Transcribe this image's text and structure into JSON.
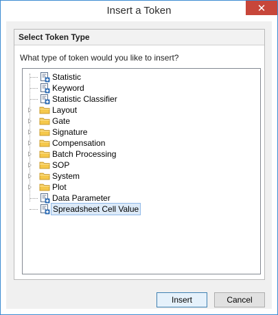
{
  "window": {
    "title": "Insert a Token",
    "close_glyph": "✕"
  },
  "panel": {
    "header": "Select Token Type",
    "question": "What type of token would you like to insert?"
  },
  "tree": {
    "items": [
      {
        "label": "Statistic",
        "kind": "token",
        "expandable": false
      },
      {
        "label": "Keyword",
        "kind": "token",
        "expandable": false
      },
      {
        "label": "Statistic Classifier",
        "kind": "token",
        "expandable": false
      },
      {
        "label": "Layout",
        "kind": "folder",
        "expandable": true
      },
      {
        "label": "Gate",
        "kind": "folder",
        "expandable": true
      },
      {
        "label": "Signature",
        "kind": "folder",
        "expandable": true
      },
      {
        "label": "Compensation",
        "kind": "folder",
        "expandable": true
      },
      {
        "label": "Batch Processing",
        "kind": "folder",
        "expandable": true
      },
      {
        "label": "SOP",
        "kind": "folder",
        "expandable": true
      },
      {
        "label": "System",
        "kind": "folder",
        "expandable": true
      },
      {
        "label": "Plot",
        "kind": "folder",
        "expandable": true
      },
      {
        "label": "Data Parameter",
        "kind": "token",
        "expandable": false
      },
      {
        "label": "Spreadsheet Cell Value",
        "kind": "token",
        "expandable": false,
        "selected": true
      }
    ]
  },
  "buttons": {
    "insert": "Insert",
    "cancel": "Cancel"
  },
  "colors": {
    "accent": "#3b8ad1",
    "close": "#c7463a",
    "folder": "#f5c84c",
    "selection": "#dceaf8"
  }
}
